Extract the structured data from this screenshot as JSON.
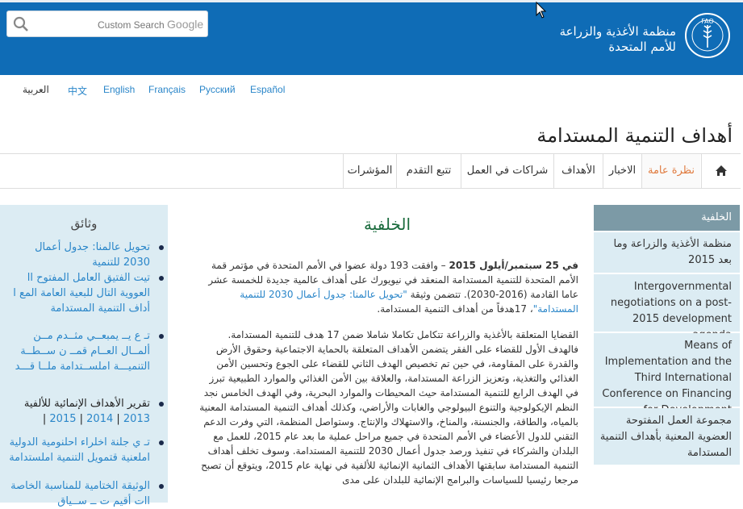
{
  "header": {
    "search_placeholder": "Custom Search",
    "search_brand": "Google",
    "org_name_line1": "منظمة الأغذية والزراعة",
    "org_name_line2": "للأمم المتحدة",
    "logo_text": "FAO",
    "colors": {
      "brand": "#0f6cb6",
      "accent": "#e07b3f",
      "sidebar": "#dcecf3"
    }
  },
  "languages": [
    "العربية",
    "中文",
    "English",
    "Français",
    "Русский",
    "Español"
  ],
  "page_title": "أهداف التنمية المستدامة",
  "nav": {
    "home_icon": "home-icon",
    "items": [
      "نظرة عامة",
      "الاخبار",
      "الأهداف",
      "شراكات في العمل",
      "تتبع التقدم",
      "المؤشرات"
    ]
  },
  "left_sidebar": {
    "title": "وثائق",
    "docs": [
      "تحويل عالمنا: جدول أعمال 2030 للتنمية",
      "تيت الفتيق العامل المفتوح اا العووية التال للبعية العامة المع ا أداف التنمية المستدامة",
      "تـ ع يــ يمبعــي مثــدم مــن ألمــال العــام قمــ ن ســطــة التنميـــة املســتدامة ملــا قـــد",
      "تقرير الأهداف الإنمائية للألفية",
      "تـ ي جلنة اخلراء احلنومية الدولية املعنية قتمويل التنمية املستدامة",
      "الوثيقة الختامية للمناسبة الخاصة اات أقيم ت ــ ســياق"
    ],
    "years": [
      "2015",
      "2014",
      "2013"
    ]
  },
  "main": {
    "title": "الخلفية",
    "p1_bold": "في 25 سبتمبر/أيلول  2015",
    "p1_rest": " – وافقت 193 دولة عضوا في الأمم المتحدة  في مؤتمر قمة الأمم المتحدة للتنمية المستدامة المنعقد في نيويورك على أهداف عالمية جديدة للخمسة عشر عاما القادمة (2016-2030).   تتضمن وثيقة ",
    "p1_link": "\"تحويل عالمنا: جدول أعمال 2030 للتنمية المستدامة\"",
    "p1_end": "، 17هدفاً من أهداف التنمية المستدامة.",
    "p2": "القضايا المتعلقة بالأغذية والزراعة تتكامل تكاملا شاملا ضمن 17 هدف للتنمية المستدامة. فالهدف الأول للقضاء على الفقر يتضمن الأهداف المتعلقة بالحماية الاجتماعية وحقوق الأرض والقدرة على المقاومة، في حين تم تخصيص الهدف الثاني للقضاء على الجوع وتحسين الأمن الغذائي والتغذية، وتعزيز الزراعة المستدامة، والعلاقة بين الأمن الغذائي والموارد الطبيعية تبرز في الهدف الرابع للتنمية المستدامة حيث المحيطات والموارد البحرية، وفي الهدف الخامس نجد النظم الإيكولوجية والتنوع البيولوجي والغابات والأراضي، وكذلك أهداف التنمية المستدامة المعنية بالمياه، والطاقة، والجنسنة، والمناخ، والاستهلاك والإنتاج. وستواصل المنظمة، التي وفرت الدعم التقني للدول الأعضاء في الأمم المتحدة في جميع مراحل عملية ما بعد عام 2015، للعمل مع البلدان والشركاء في تنفيذ ورصد جدول أعمال 2030 للتنمية المستدامة. وسوف تخلف أهداف التنمية المستدامة سابقتها الأهداف الثمانية الإنمائية للألفية في نهاية عام 2015، ويتوقع أن تصبح مرجعا رئيسيا للسياسات والبرامج الإنمائية للبلدان على مدى"
  },
  "right_sidebar": {
    "head": "الخلفية",
    "items": [
      "منظمة الأغذية والزراعة وما بعد 2015",
      "Intergovernmental negotiations on a post-2015 development agenda",
      "Means of Implementation and the Third International Conference on Financing for Development",
      "مجموعة العمل المفتوحة العضوية المعنية بأهداف التنمية المستدامة"
    ]
  }
}
